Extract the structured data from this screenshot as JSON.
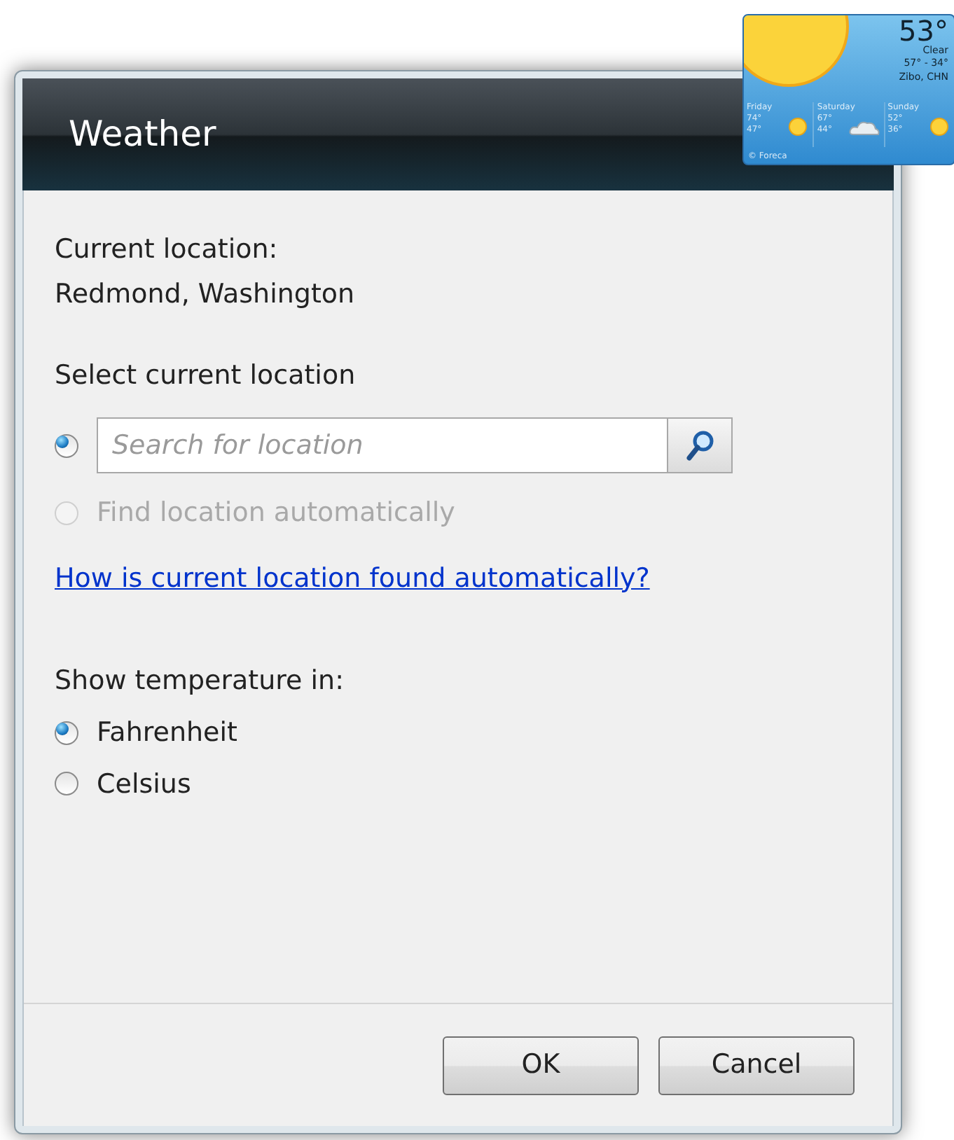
{
  "window": {
    "title": "Weather"
  },
  "gadget": {
    "temperature": "53°",
    "condition": "Clear",
    "range": "57° - 34°",
    "city": "Zibo, CHN",
    "credit": "© Foreca",
    "days": [
      {
        "name": "Friday",
        "high": "74°",
        "low": "47°",
        "kind": "sun"
      },
      {
        "name": "Saturday",
        "high": "67°",
        "low": "44°",
        "kind": "cloud"
      },
      {
        "name": "Sunday",
        "high": "52°",
        "low": "36°",
        "kind": "sun"
      }
    ]
  },
  "current_location": {
    "label": "Current location:",
    "value": "Redmond, Washington"
  },
  "select_location": {
    "label": "Select current location",
    "options": [
      {
        "kind": "search",
        "placeholder": "Search for location",
        "selected": true,
        "disabled": false
      },
      {
        "kind": "auto",
        "label": "Find location automatically",
        "selected": false,
        "disabled": true
      }
    ]
  },
  "help_link": "How is current location found automatically?",
  "temperature_unit": {
    "label": "Show temperature in:",
    "options": [
      {
        "label": "Fahrenheit",
        "selected": true
      },
      {
        "label": "Celsius",
        "selected": false
      }
    ]
  },
  "buttons": [
    "OK",
    "Cancel"
  ]
}
